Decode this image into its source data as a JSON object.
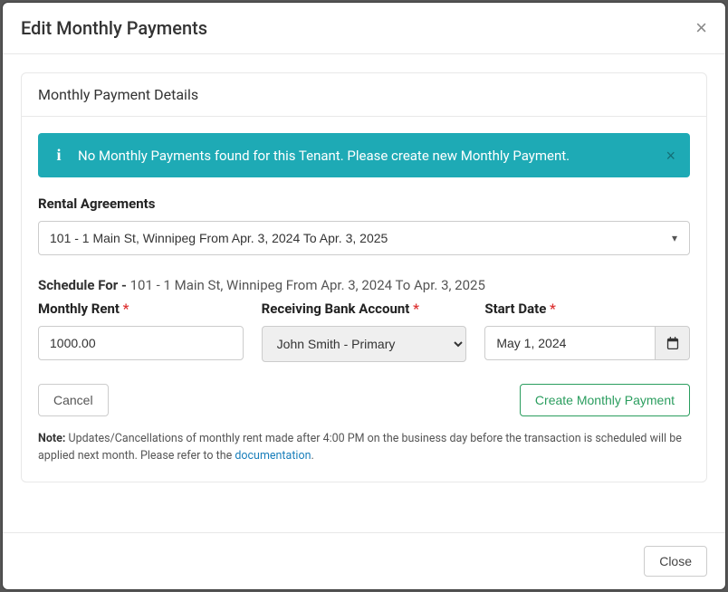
{
  "modal": {
    "title": "Edit Monthly Payments",
    "footer_close": "Close"
  },
  "panel": {
    "title": "Monthly Payment Details"
  },
  "alert": {
    "message": "No Monthly Payments found for this Tenant. Please create new Monthly Payment."
  },
  "rental_agreements": {
    "label": "Rental Agreements",
    "selected": "101 - 1 Main St, Winnipeg From Apr. 3, 2024 To Apr. 3, 2025"
  },
  "schedule": {
    "label": "Schedule For - ",
    "value": "101 - 1 Main St, Winnipeg From Apr. 3, 2024 To Apr. 3, 2025"
  },
  "fields": {
    "monthly_rent": {
      "label": "Monthly Rent",
      "value": "1000.00"
    },
    "receiving_account": {
      "label": "Receiving Bank Account",
      "selected": "John Smith - Primary"
    },
    "start_date": {
      "label": "Start Date",
      "value": "May 1, 2024"
    }
  },
  "buttons": {
    "cancel": "Cancel",
    "create": "Create Monthly Payment"
  },
  "note": {
    "label": "Note:",
    "text_before": " Updates/Cancellations of monthly rent made after 4:00 PM on the business day before the transaction is scheduled will be applied next month. Please refer to the ",
    "link": "documentation",
    "text_after": "."
  }
}
